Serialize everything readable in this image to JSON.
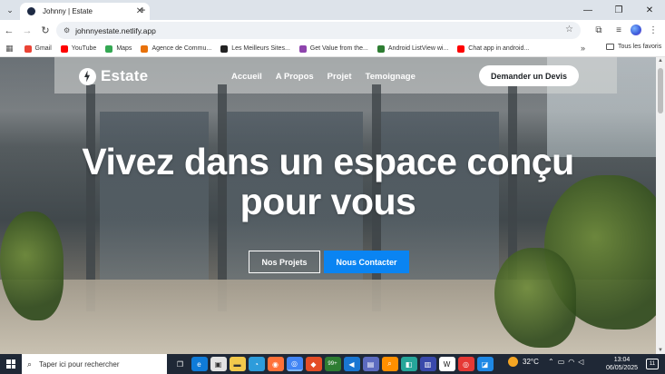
{
  "browser": {
    "tab": {
      "title": "Johnny | Estate",
      "close": "✕"
    },
    "new_tab": "+",
    "window_controls": {
      "minimize": "—",
      "restore": "❐",
      "close": "✕"
    },
    "url": "johnnyestate.netlify.app",
    "bookmarks": [
      {
        "label": "Gmail",
        "color": "#ea4335"
      },
      {
        "label": "YouTube",
        "color": "#ff0000"
      },
      {
        "label": "Maps",
        "color": "#34a853"
      },
      {
        "label": "Agence de Commu...",
        "color": "#e8710a"
      },
      {
        "label": "Les Meilleurs Sites...",
        "color": "#222222"
      },
      {
        "label": "Get Value from the...",
        "color": "#8e44ad"
      },
      {
        "label": "Android ListView wi...",
        "color": "#2e7d32"
      },
      {
        "label": "Chat app in android...",
        "color": "#ff0000"
      }
    ],
    "bookmarks_more": "»",
    "bookmarks_folder": "Tous les favoris"
  },
  "site": {
    "logo": "Estate",
    "nav": [
      "Accueil",
      "A Propos",
      "Projet",
      "Temoignage"
    ],
    "cta": "Demander un Devis",
    "headline_line1": "Vivez dans un espace conçu",
    "headline_line2": "pour vous",
    "btn_projects": "Nos Projets",
    "btn_contact": "Nous Contacter"
  },
  "taskbar": {
    "search_placeholder": "Taper ici pour rechercher",
    "badge": "99+",
    "weather": "32°C",
    "time": "13:04",
    "date": "06/05/2025",
    "notifications": "11"
  }
}
